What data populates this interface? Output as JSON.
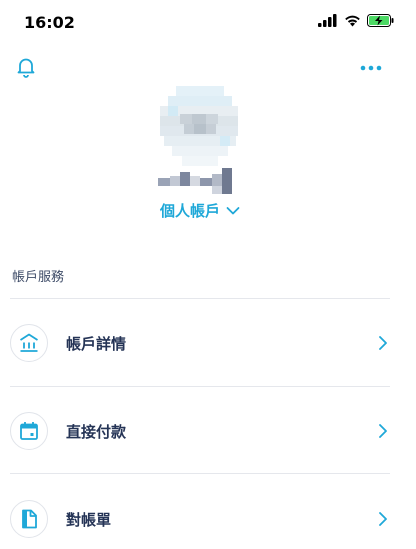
{
  "status": {
    "time": "16:02"
  },
  "header": {
    "account_label": "個人帳戶",
    "bell_icon": "bell-icon",
    "more_icon": "more-dots-icon",
    "chevron_icon": "chevron-down-icon"
  },
  "section": {
    "title": "帳戶服務"
  },
  "menu": [
    {
      "label": "帳戶詳情",
      "icon": "bank-icon"
    },
    {
      "label": "直接付款",
      "icon": "calendar-icon"
    },
    {
      "label": "對帳單",
      "icon": "document-icon"
    }
  ],
  "colors": {
    "accent": "#1fa8d8",
    "text": "#253456",
    "divider": "#e5e7ec"
  }
}
